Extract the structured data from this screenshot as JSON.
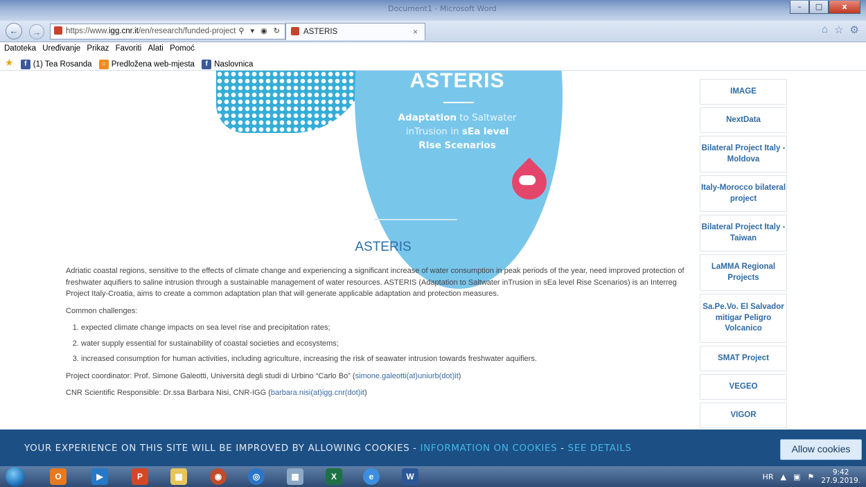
{
  "window": {
    "ghost_title": "Document1 - Microsoft Word"
  },
  "browser": {
    "address_url": "https://www.igg.cnr.it/en/research/funded-project",
    "address_url_domain": "igg.cnr.it",
    "tab_title": "ASTERIS",
    "tab_close": "×",
    "menu": [
      "Datoteka",
      "Uređivanje",
      "Prikaz",
      "Favoriti",
      "Alati",
      "Pomoć"
    ],
    "favorites": [
      "(1) Tea Rosanda",
      "Predložena web-mjesta",
      "Naslovnica"
    ]
  },
  "hero": {
    "brand": "ASTERIS",
    "tagline_lines": [
      "Adaptation to Saltwater",
      "inTrusion in sEa level",
      "RIse Scenarios"
    ]
  },
  "article": {
    "title": "ASTERIS",
    "intro": "Adriatic coastal regions, sensitive to the effects of climate change and experiencing a significant increase of water consumption in peak periods of the year, need improved protection of freshwater aquifiers to saline intrusion through a sustainable management of water resources. ASTERIS (Adaptation to Saltwater inTrusion in sEa level Rise Scenarios) is an Interreg Project Italy-Croatia, aims to create a common adaptation plan that will generate applicable adaptation and protection measures.",
    "challenges_label": "Common challenges:",
    "challenges": [
      "expected climate change impacts on sea level rise and precipitation rates;",
      "water supply essential for sustainability of coastal societies and ecosystems;",
      "increased consumption for human activities, including agriculture, increasing the risk of seawater intrusion towards freshwater aquifiers."
    ],
    "coordinator_label": "Project coordinator: Prof. Simone Galeotti, Università degli studi di Urbino “Carlo Bo” (",
    "coordinator_email": "simone.galeotti(at)uniurb(dot)it",
    "coordinator_close": ")",
    "responsible_label": "CNR Scientific Responsible: Dr.ssa Barbara Nisi, CNR-IGG (",
    "responsible_email": "barbara.nisi(at)igg.cnr(dot)it",
    "responsible_close": ")"
  },
  "sidebar": {
    "items": [
      "IMAGE",
      "NextData",
      "Bilateral Project Italy - Moldova",
      "Italy-Morocco bilateral project",
      "Bilateral Project Italy - Taiwan",
      "LaMMA Regional Projects",
      "Sa.Pe.Vo. El Salvador mitigar Peligro Volcanico",
      "SMAT Project",
      "VEGEO",
      "VIGOR"
    ]
  },
  "cookie": {
    "text": "YOUR EXPERIENCE ON THIS SITE WILL BE IMPROVED BY ALLOWING COOKIES - ",
    "info_link": "INFORMATION ON COOKIES",
    "separator": " - ",
    "details_link": "SEE DETAILS",
    "button": "Allow cookies"
  },
  "taskbar": {
    "lang": "HR",
    "time": "9:42",
    "date": "27.9.2019."
  }
}
